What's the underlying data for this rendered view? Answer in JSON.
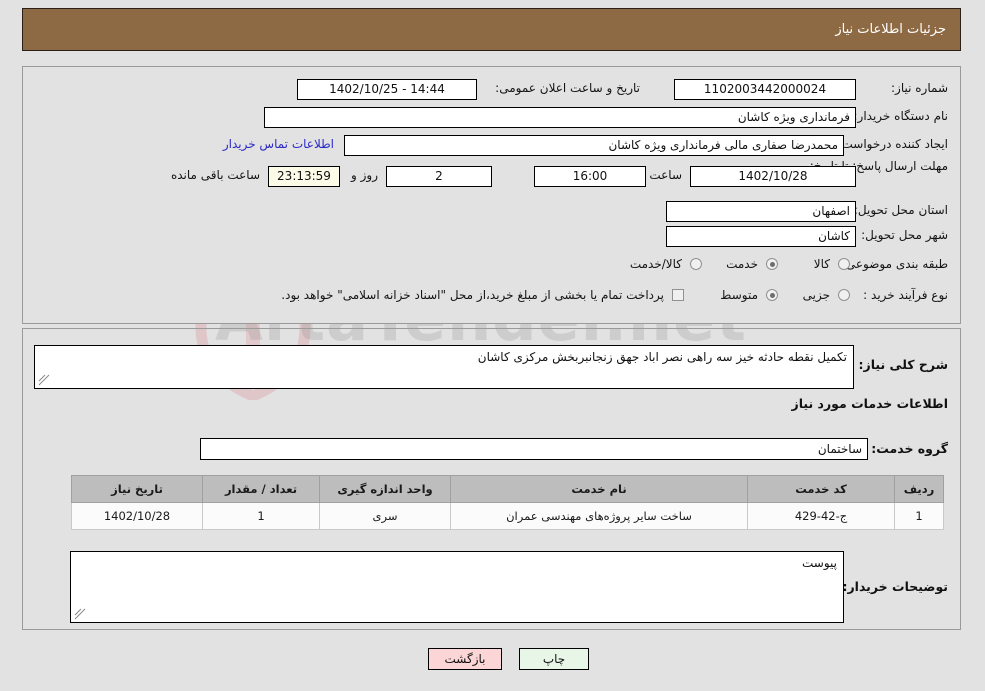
{
  "header": {
    "title": "جزئیات اطلاعات نیاز"
  },
  "watermark": {
    "text": "ArtaTender.net"
  },
  "fields": {
    "need_number_label": "شماره نیاز:",
    "need_number_value": "1102003442000024",
    "announce_label": "تاریخ و ساعت اعلان عمومی:",
    "announce_value": "14:44 - 1402/10/25",
    "buyer_org_label": "نام دستگاه خریدار:",
    "buyer_org_value": "فرمانداری ویژه کاشان",
    "requester_label": "ایجاد کننده درخواست:",
    "requester_value": "محمدرضا صفاری مالی فرمانداری ویژه کاشان",
    "contact_link": "اطلاعات تماس خریدار",
    "deadline_label": "مهلت ارسال پاسخ: تا تاریخ:",
    "deadline_date": "1402/10/28",
    "deadline_hour_label": "ساعت",
    "deadline_hour": "16:00",
    "remaining_days": "2",
    "remaining_days_label": "روز و",
    "remaining_timer": "23:13:59",
    "remaining_suffix": "ساعت باقی مانده",
    "province_label": "استان محل تحویل:",
    "province_value": "اصفهان",
    "city_label": "شهر محل تحویل:",
    "city_value": "کاشان",
    "category_label": "طبقه بندی موضوعی:",
    "process_label": "نوع فرآیند خرید :",
    "treasury_note": "پرداخت تمام یا بخشی از مبلغ خرید،از محل \"اسناد خزانه اسلامی\" خواهد بود."
  },
  "category_options": [
    {
      "label": "کالا",
      "selected": false
    },
    {
      "label": "خدمت",
      "selected": true
    },
    {
      "label": "کالا/خدمت",
      "selected": false
    }
  ],
  "process_options": [
    {
      "label": "جزیی",
      "selected": false
    },
    {
      "label": "متوسط",
      "selected": true
    }
  ],
  "treasury_checkbox": {
    "checked": false
  },
  "description": {
    "label": "شرح کلی نیاز:",
    "value": "تکمیل نقطه حادثه خیز سه راهی نصر اباد جهق زنجانبربخش مرکزی کاشان"
  },
  "services_section": {
    "heading": "اطلاعات خدمات مورد نیاز",
    "group_label": "گروه خدمت:",
    "group_value": "ساختمان"
  },
  "table": {
    "columns": [
      "ردیف",
      "کد خدمت",
      "نام خدمت",
      "واحد اندازه گیری",
      "تعداد / مقدار",
      "تاریخ نیاز"
    ],
    "rows": [
      {
        "radif": "1",
        "code": "ج-42-429",
        "name": "ساخت سایر پروژه‌های مهندسی عمران",
        "unit": "سری",
        "qty": "1",
        "date": "1402/10/28"
      }
    ]
  },
  "buyer_notes": {
    "label": "توضیحات خریدار:",
    "value": "پیوست"
  },
  "footer": {
    "print_label": "چاپ",
    "back_label": "بازگشت"
  },
  "colors": {
    "header_bg": "#8d6a43",
    "page_bg": "#e2e2e2",
    "link": "#2a2ac8",
    "timer_bg": "#fbfbe8",
    "print_btn_bg": "#e7f6e7",
    "back_btn_bg": "#fcd6d6",
    "table_header_bg": "#bdbdbd"
  }
}
